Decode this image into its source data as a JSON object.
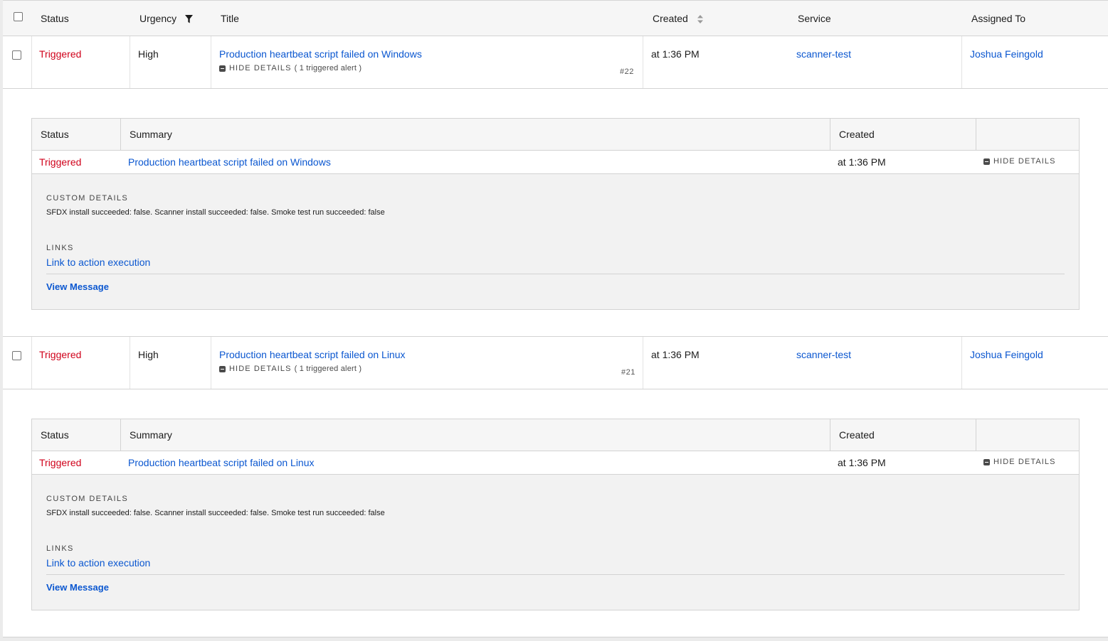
{
  "table": {
    "columns": {
      "status": "Status",
      "urgency": "Urgency",
      "title": "Title",
      "created": "Created",
      "service": "Service",
      "assigned": "Assigned To"
    },
    "filter_icon": "filter-icon",
    "sort_icon": "sort-icon"
  },
  "incidents": [
    {
      "status": "Triggered",
      "urgency": "High",
      "title": "Production heartbeat script failed on Windows",
      "toggle_label": "HIDE DETAILS",
      "alert_count": "( 1 triggered alert )",
      "number": "#22",
      "created": "at 1:36 PM",
      "service": "scanner-test",
      "assigned": "Joshua Feingold",
      "alert": {
        "columns": {
          "status": "Status",
          "summary": "Summary",
          "created": "Created"
        },
        "status": "Triggered",
        "summary": "Production heartbeat script failed on Windows",
        "created": "at 1:36 PM",
        "toggle_label": "HIDE DETAILS",
        "custom_details_label": "CUSTOM DETAILS",
        "custom_details": "SFDX install succeeded: false. Scanner install succeeded: false. Smoke test run succeeded: false",
        "links_label": "LINKS",
        "link_text": "Link to action execution",
        "view_message": "View Message"
      }
    },
    {
      "status": "Triggered",
      "urgency": "High",
      "title": "Production heartbeat script failed on Linux",
      "toggle_label": "HIDE DETAILS",
      "alert_count": "( 1 triggered alert )",
      "number": "#21",
      "created": "at 1:36 PM",
      "service": "scanner-test",
      "assigned": "Joshua Feingold",
      "alert": {
        "columns": {
          "status": "Status",
          "summary": "Summary",
          "created": "Created"
        },
        "status": "Triggered",
        "summary": "Production heartbeat script failed on Linux",
        "created": "at 1:36 PM",
        "toggle_label": "HIDE DETAILS",
        "custom_details_label": "CUSTOM DETAILS",
        "custom_details": "SFDX install succeeded: false. Scanner install succeeded: false. Smoke test run succeeded: false",
        "links_label": "LINKS",
        "link_text": "Link to action execution",
        "view_message": "View Message"
      }
    }
  ],
  "colors": {
    "triggered": "#d0021b",
    "link": "#0b57d0"
  }
}
